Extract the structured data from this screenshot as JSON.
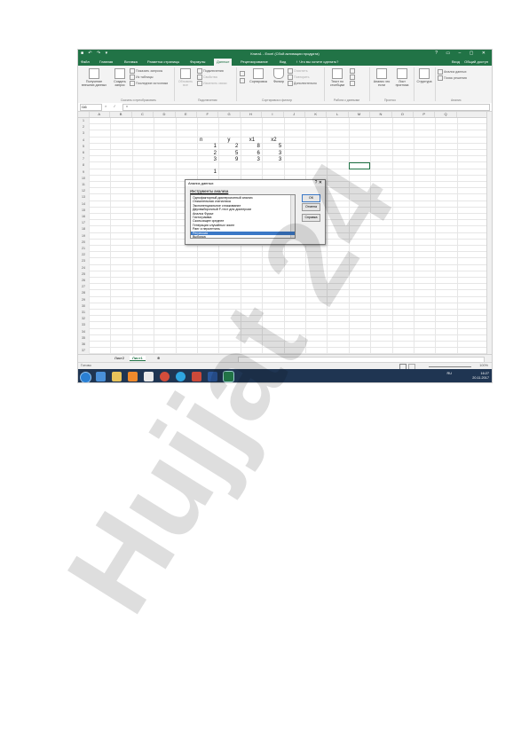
{
  "window": {
    "title": "Книга1 - Excel (Сбой активации продукта)",
    "qat": "■ ↶ ↷ ▾",
    "controls": "? ▭ – ▢ ✕"
  },
  "tabs": [
    {
      "label": "Файл"
    },
    {
      "label": "Главная"
    },
    {
      "label": "Вставка"
    },
    {
      "label": "Разметка страницы"
    },
    {
      "label": "Формулы"
    },
    {
      "label": "Данные"
    },
    {
      "label": "Рецензирование"
    },
    {
      "label": "Вид"
    },
    {
      "label": "♀ Что вы хотите сделать?"
    }
  ],
  "tabs_right": {
    "signin": "Вход",
    "share": "Общий доступ"
  },
  "ribbon": {
    "get_external": "Получение внешних данных",
    "new_query": "Создать запрос",
    "show_queries": "Показать запросы",
    "from_table": "Из таблицы",
    "recent_sources": "Последние источники",
    "group_get_transform": "Скачать и преобразовать",
    "refresh_all": "Обновить все",
    "connections": "Подключения",
    "properties": "Свойства",
    "edit_links": "Изменить связи",
    "group_connections": "Подключения",
    "sort": "Сортировка",
    "filter": "Фильтр",
    "clear": "Очистить",
    "reapply": "Повторить",
    "advanced": "Дополнительно",
    "group_sort_filter": "Сортировка и фильтр",
    "text_to_columns": "Текст по столбцам",
    "group_data_tools": "Работа с данными",
    "what_if": "Анализ что если",
    "forecast_sheet": "Лист прогноза",
    "group_forecast": "Прогноз",
    "outline": "Структура",
    "data_analysis": "Анализ данных",
    "solver": "Поиск решения",
    "group_analysis": "Анализ"
  },
  "formula_bar": {
    "name_box": "I16",
    "fx": "× ✓ fx",
    "value": ""
  },
  "columns": [
    "A",
    "B",
    "C",
    "D",
    "E",
    "F",
    "G",
    "H",
    "I",
    "J",
    "K",
    "L",
    "M",
    "N",
    "O",
    "P",
    "Q"
  ],
  "rows": [
    "1",
    "2",
    "3",
    "4",
    "5",
    "6",
    "7",
    "8",
    "9",
    "10",
    "11",
    "12",
    "13",
    "14",
    "15",
    "16",
    "17",
    "18",
    "19",
    "20",
    "21",
    "22",
    "23",
    "24",
    "25",
    "26",
    "27",
    "28",
    "29",
    "30",
    "31",
    "32",
    "33",
    "34",
    "35",
    "36",
    "37"
  ],
  "table": {
    "headers": [
      "n",
      "y",
      "x1",
      "x2"
    ],
    "rows": [
      [
        "1",
        "2",
        "8",
        "5"
      ],
      [
        "2",
        "5",
        "6",
        "3"
      ],
      [
        "3",
        "9",
        "3",
        "3"
      ]
    ],
    "partial_n": [
      "1",
      "",
      "1",
      "1"
    ]
  },
  "sheets": {
    "tab1": "Лист2",
    "tab2": "Лист1",
    "add": "⊕"
  },
  "status": {
    "ready": "Готово",
    "zoom": "100%"
  },
  "taskbar": {
    "lang": "RU",
    "time": "16:27",
    "date": "20.11.2017"
  },
  "dialog": {
    "title": "Анализ данных",
    "close": "?  ✕",
    "label": "Инструменты анализа",
    "items": [
      "Однофакторный дисперсионный анализ",
      "Описательная статистика",
      "Экспоненциальное сглаживание",
      "Двухвыборочный F-тест для дисперсии",
      "Анализ Фурье",
      "Гистограмма",
      "Скользящее среднее",
      "Генерация случайных чисел",
      "Ранг и персентиль",
      "Регрессия",
      "Выборка"
    ],
    "selected_index": 9,
    "ok": "ОК",
    "cancel": "Отмена",
    "help": "Справка"
  },
  "watermark": {
    "text": "Hujjat 24",
    "color": "#b58cf0"
  }
}
